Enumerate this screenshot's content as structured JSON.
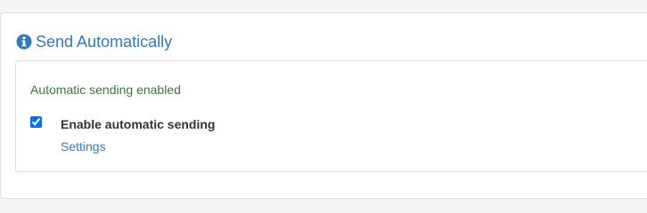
{
  "section": {
    "title": "Send Automatically",
    "icon": "info-icon",
    "title_color": "#337ab7"
  },
  "status": {
    "text": "Automatic sending enabled",
    "color": "#3c763d"
  },
  "auto_send": {
    "checked": true,
    "label": "Enable automatic sending"
  },
  "settings_link": {
    "label": "Settings"
  }
}
